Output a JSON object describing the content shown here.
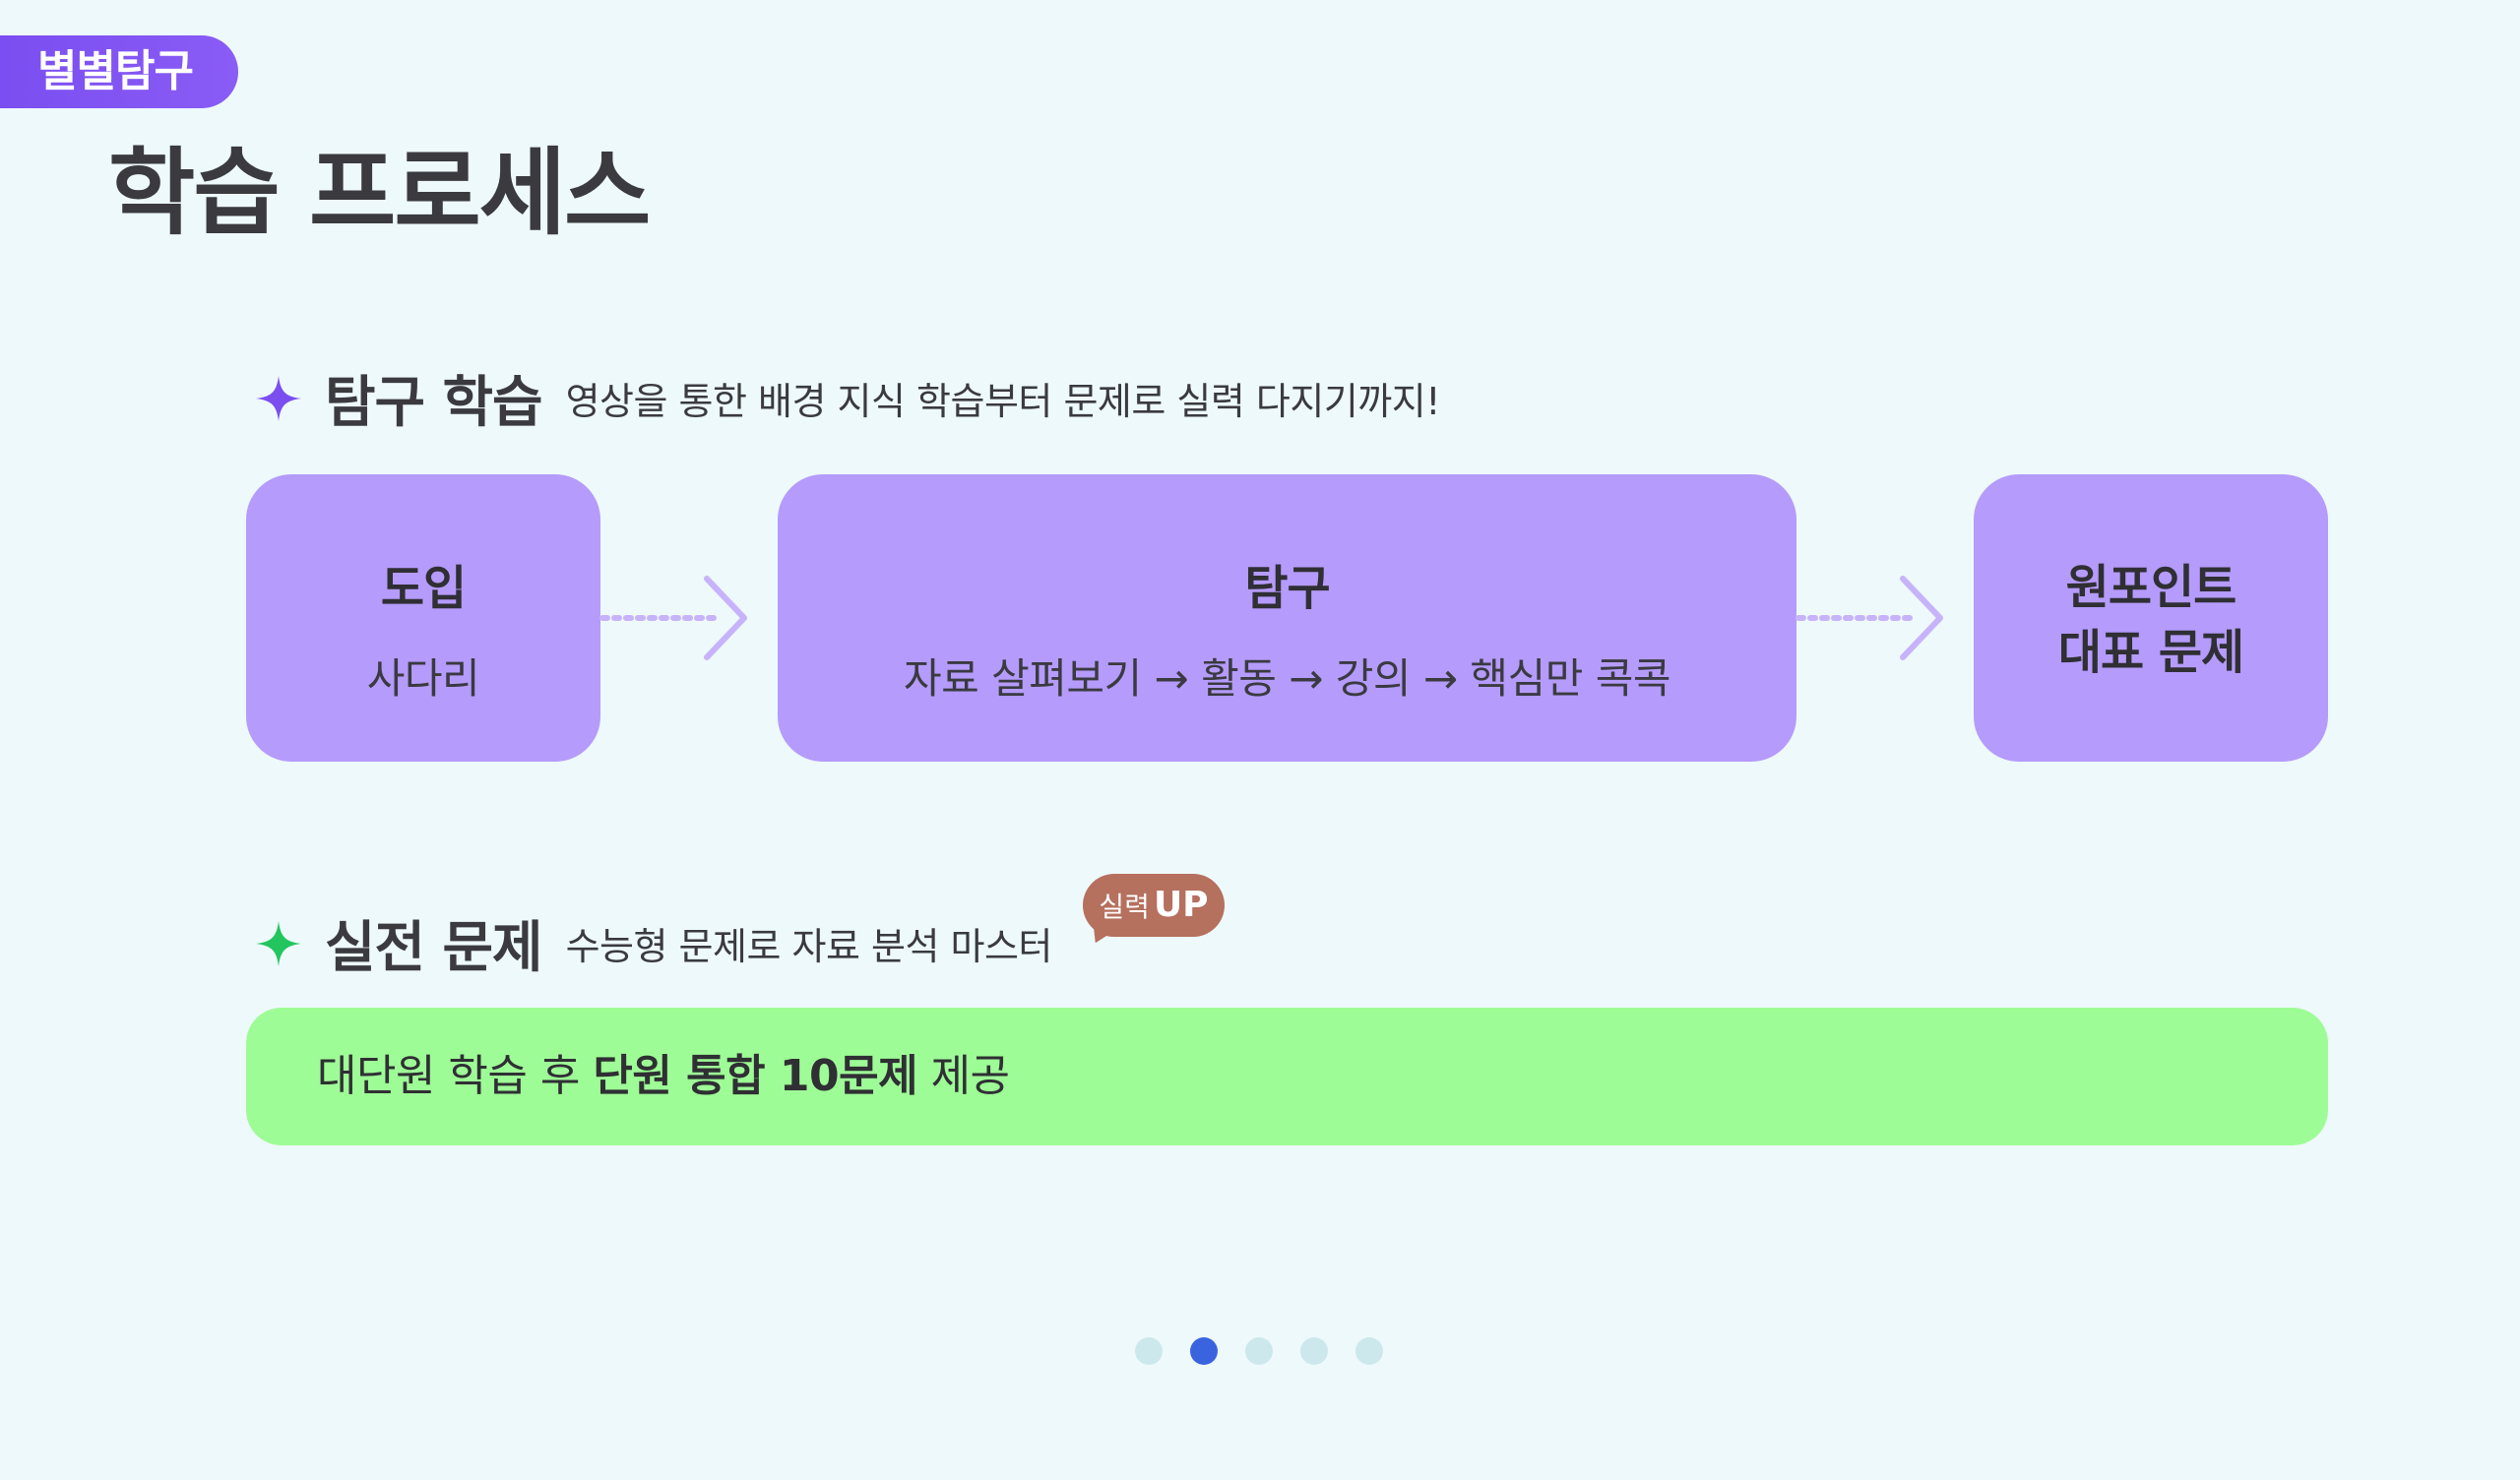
{
  "tag": {
    "label": "별별탐구"
  },
  "title": "학습 프로세스",
  "section1": {
    "title": "탐구 학습",
    "description": "영상을 통한 배경 지식 학습부터 문제로 실력 다지기까지!",
    "star_color": "#7b4ef0"
  },
  "steps": [
    {
      "title": "도입",
      "subtitle": "사다리"
    },
    {
      "title": "탐구",
      "subtitle": "자료 살펴보기 → 활동 → 강의 → 핵심만 콕콕"
    },
    {
      "title_line1": "원포인트",
      "title_line2": "대표 문제"
    }
  ],
  "section2": {
    "title": "실전 문제",
    "description": "수능형 문제로 자료 분석 마스터",
    "star_color": "#22c55e",
    "badge_small": "실력",
    "badge_big": "UP"
  },
  "banner": {
    "part1": "대단원 학습 후 ",
    "part2": "단원 통합 10문제",
    "part3": " 제공"
  },
  "pager": {
    "total": 5,
    "active_index": 1
  },
  "colors": {
    "accent_purple": "#7a4ef0",
    "step_fill": "#b59bfb",
    "banner_fill": "#9efc96",
    "badge_fill": "#b5705e",
    "dot_active": "#3a63e0",
    "dot_inactive": "#cce8ec",
    "background": "#eef9fb"
  }
}
